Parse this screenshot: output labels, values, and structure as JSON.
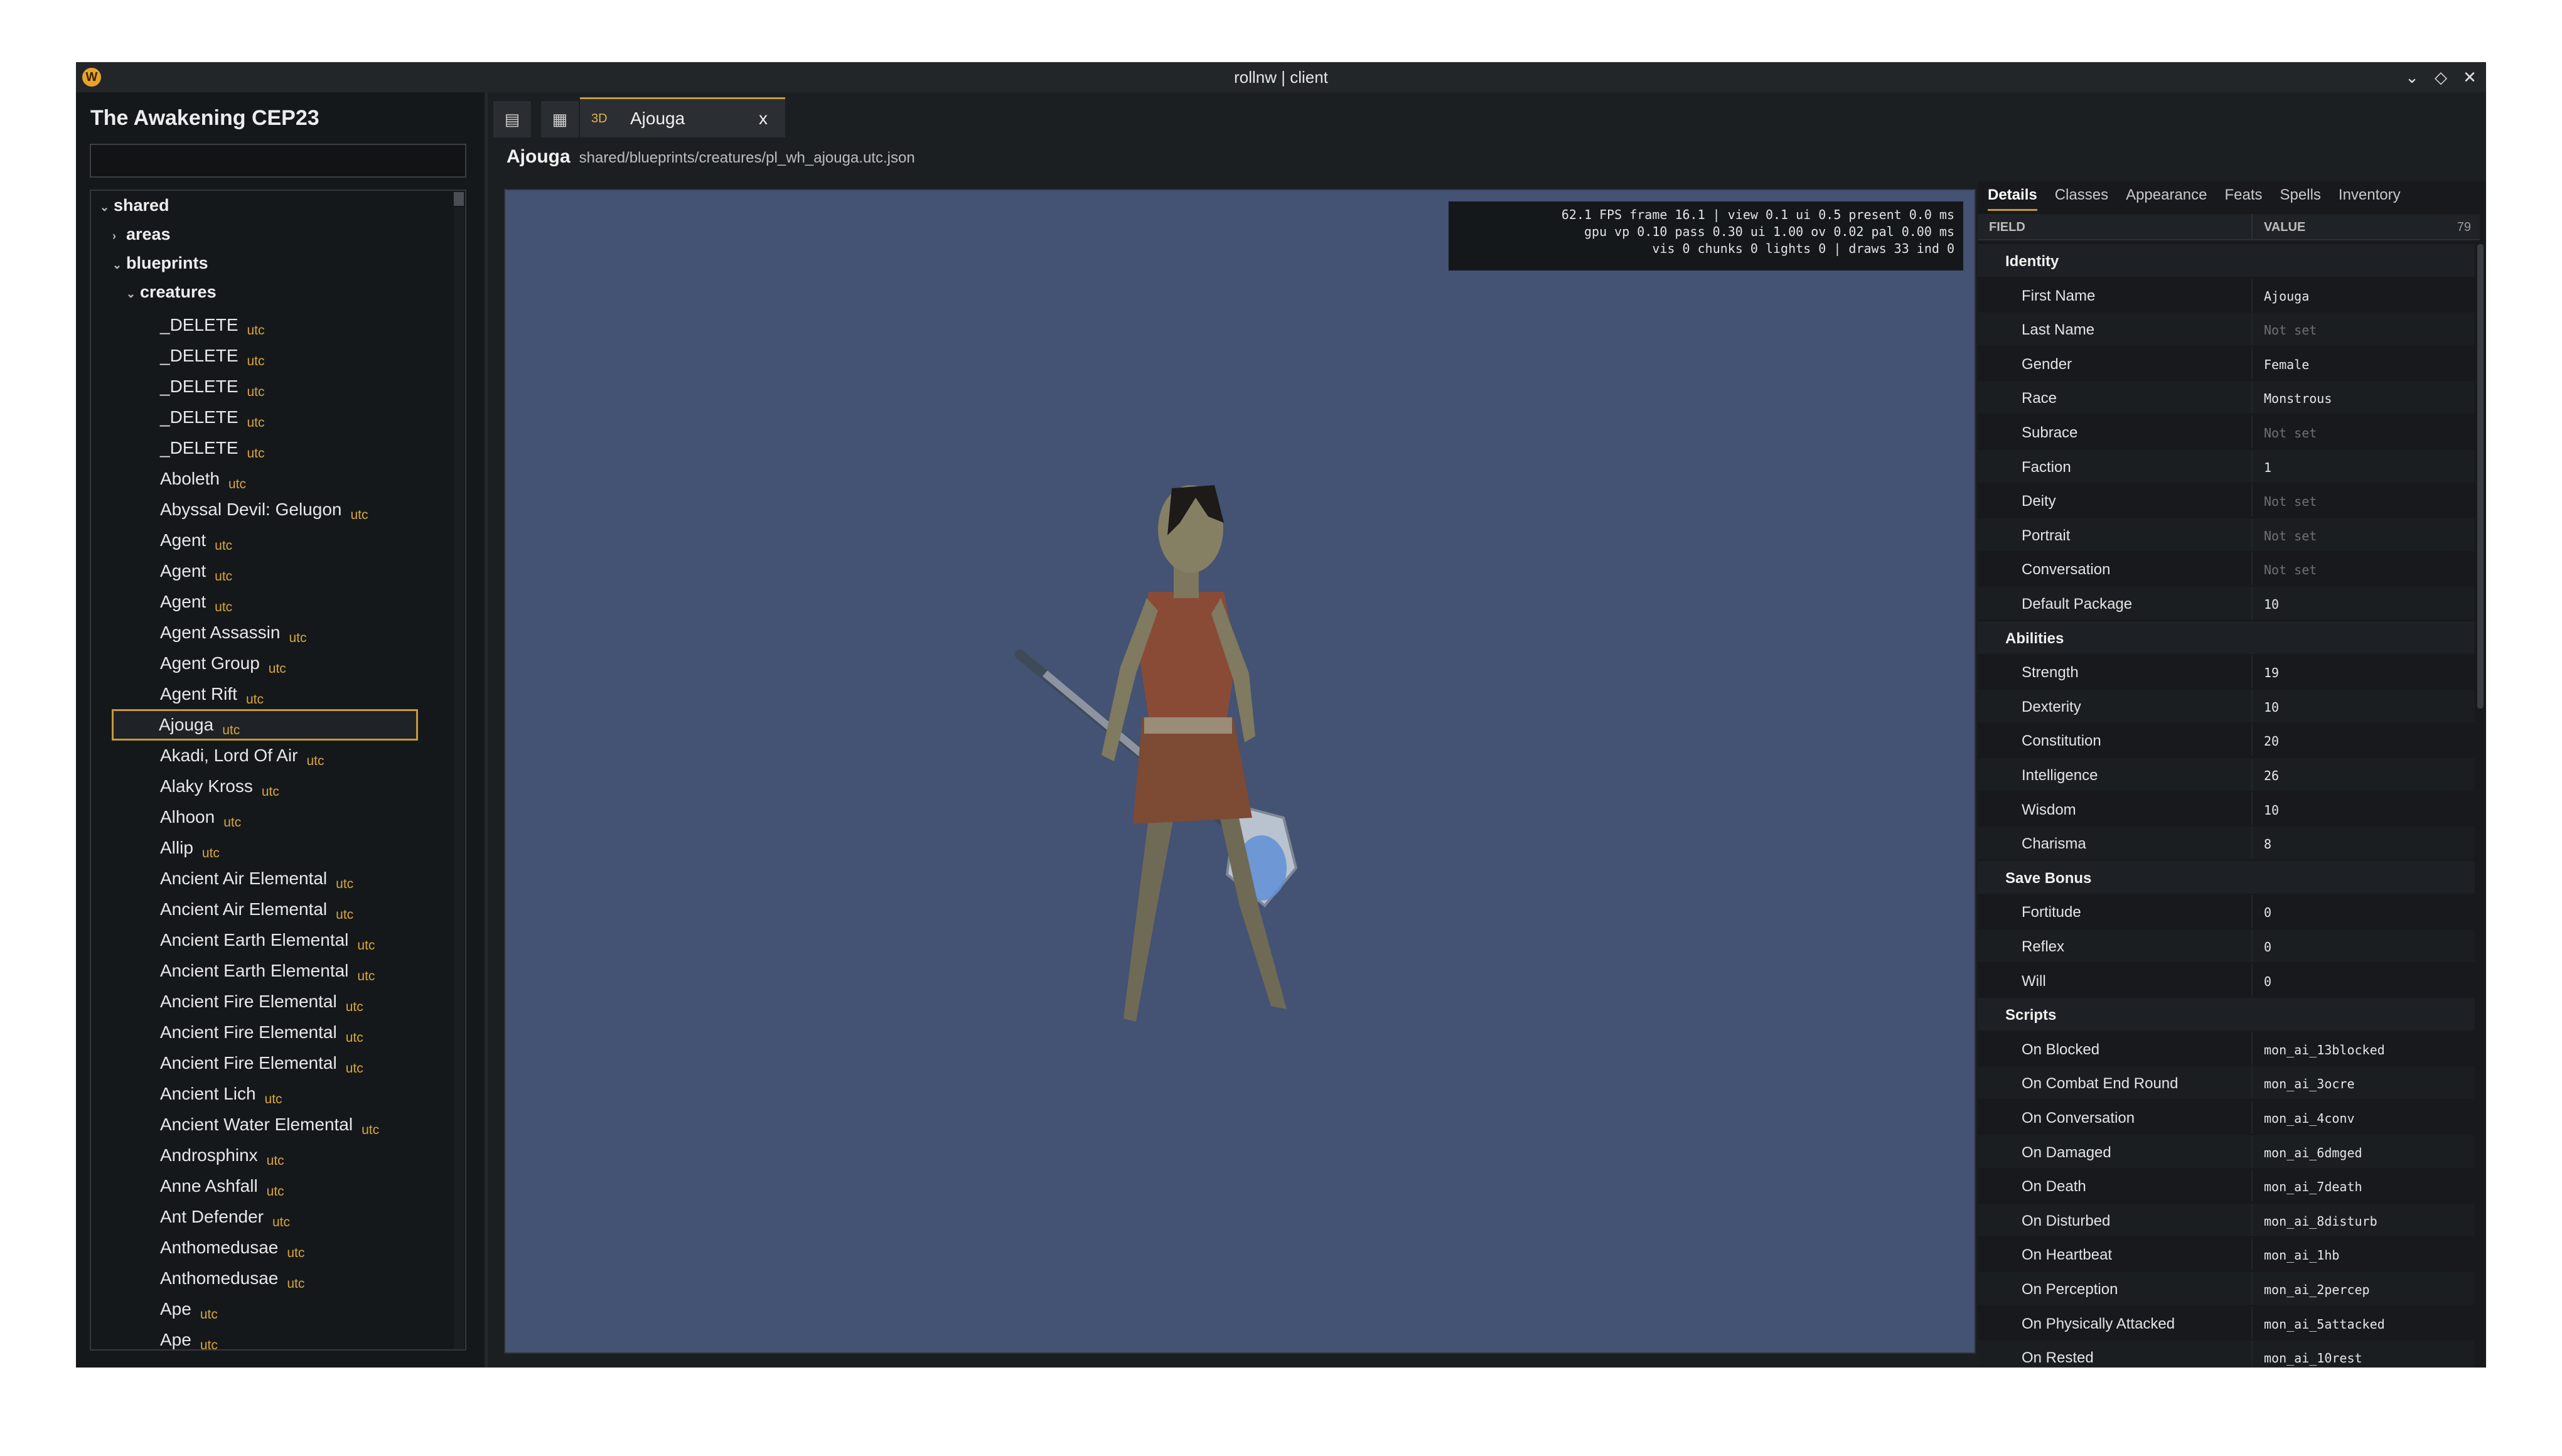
{
  "window": {
    "title": "rollnw | client",
    "logo_glyph": "W",
    "controls": [
      "⌄",
      "◇",
      "✕"
    ]
  },
  "sidebar": {
    "project_title": "The Awakening CEP23",
    "search_value": "",
    "folders": {
      "shared": "shared",
      "areas": "areas",
      "blueprints": "blueprints",
      "creatures": "creatures"
    },
    "items": [
      {
        "name": "_DELETE",
        "ext": "utc"
      },
      {
        "name": "_DELETE",
        "ext": "utc"
      },
      {
        "name": "_DELETE",
        "ext": "utc"
      },
      {
        "name": "_DELETE",
        "ext": "utc"
      },
      {
        "name": "_DELETE",
        "ext": "utc"
      },
      {
        "name": "Aboleth",
        "ext": "utc"
      },
      {
        "name": "Abyssal Devil: Gelugon",
        "ext": "utc"
      },
      {
        "name": "Agent",
        "ext": "utc"
      },
      {
        "name": "Agent",
        "ext": "utc"
      },
      {
        "name": "Agent",
        "ext": "utc"
      },
      {
        "name": "Agent Assassin",
        "ext": "utc"
      },
      {
        "name": "Agent Group",
        "ext": "utc"
      },
      {
        "name": "Agent Rift",
        "ext": "utc"
      },
      {
        "name": "Ajouga",
        "ext": "utc"
      },
      {
        "name": "Akadi, Lord Of Air",
        "ext": "utc"
      },
      {
        "name": "Alaky Kross",
        "ext": "utc"
      },
      {
        "name": "Alhoon",
        "ext": "utc"
      },
      {
        "name": "Allip",
        "ext": "utc"
      },
      {
        "name": "Ancient Air Elemental",
        "ext": "utc"
      },
      {
        "name": "Ancient Air Elemental",
        "ext": "utc"
      },
      {
        "name": "Ancient Earth Elemental",
        "ext": "utc"
      },
      {
        "name": "Ancient Earth Elemental",
        "ext": "utc"
      },
      {
        "name": "Ancient Fire Elemental",
        "ext": "utc"
      },
      {
        "name": "Ancient Fire Elemental",
        "ext": "utc"
      },
      {
        "name": "Ancient Fire Elemental",
        "ext": "utc"
      },
      {
        "name": "Ancient Lich",
        "ext": "utc"
      },
      {
        "name": "Ancient Water Elemental",
        "ext": "utc"
      },
      {
        "name": "Androsphinx",
        "ext": "utc"
      },
      {
        "name": "Anne Ashfall",
        "ext": "utc"
      },
      {
        "name": "Ant Defender",
        "ext": "utc"
      },
      {
        "name": "Anthomedusae",
        "ext": "utc"
      },
      {
        "name": "Anthomedusae",
        "ext": "utc"
      },
      {
        "name": "Ape",
        "ext": "utc"
      },
      {
        "name": "Ape",
        "ext": "utc"
      }
    ],
    "selected_index": 13
  },
  "editor": {
    "tab_badge": "3D",
    "tab_label": "Ajouga",
    "tab_close": "x",
    "breadcrumb_name": "Ajouga",
    "breadcrumb_path": "shared/blueprints/creatures/pl_wh_ajouga.utc.json",
    "stats": [
      "62.1 FPS frame 16.1 | view 0.1 ui 0.5 present 0.0 ms",
      "gpu vp 0.10 pass 0.30 ui 1.00 ov 0.02 pal 0.00 ms",
      "vis 0 chunks 0 lights 0 | draws 33 ind 0"
    ]
  },
  "properties": {
    "tabs": [
      "Details",
      "Classes",
      "Appearance",
      "Feats",
      "Spells",
      "Inventory"
    ],
    "active_tab": "Details",
    "header_field": "FIELD",
    "header_value": "VALUE",
    "row_count": "79",
    "rows": [
      {
        "group": "Identity"
      },
      {
        "field": "First Name",
        "value": "Ajouga"
      },
      {
        "field": "Last Name",
        "value": "Not set",
        "empty": true
      },
      {
        "field": "Gender",
        "value": "Female"
      },
      {
        "field": "Race",
        "value": "Monstrous"
      },
      {
        "field": "Subrace",
        "value": "Not set",
        "empty": true
      },
      {
        "field": "Faction",
        "value": "1"
      },
      {
        "field": "Deity",
        "value": "Not set",
        "empty": true
      },
      {
        "field": "Portrait",
        "value": "Not set",
        "empty": true
      },
      {
        "field": "Conversation",
        "value": "Not set",
        "empty": true
      },
      {
        "field": "Default Package",
        "value": "10"
      },
      {
        "group": "Abilities"
      },
      {
        "field": "Strength",
        "value": "19"
      },
      {
        "field": "Dexterity",
        "value": "10"
      },
      {
        "field": "Constitution",
        "value": "20"
      },
      {
        "field": "Intelligence",
        "value": "26"
      },
      {
        "field": "Wisdom",
        "value": "10"
      },
      {
        "field": "Charisma",
        "value": "8"
      },
      {
        "group": "Save Bonus"
      },
      {
        "field": "Fortitude",
        "value": "0"
      },
      {
        "field": "Reflex",
        "value": "0"
      },
      {
        "field": "Will",
        "value": "0"
      },
      {
        "group": "Scripts"
      },
      {
        "field": "On Blocked",
        "value": "mon_ai_13blocked"
      },
      {
        "field": "On Combat End Round",
        "value": "mon_ai_3ocre"
      },
      {
        "field": "On Conversation",
        "value": "mon_ai_4conv"
      },
      {
        "field": "On Damaged",
        "value": "mon_ai_6dmged"
      },
      {
        "field": "On Death",
        "value": "mon_ai_7death"
      },
      {
        "field": "On Disturbed",
        "value": "mon_ai_8disturb"
      },
      {
        "field": "On Heartbeat",
        "value": "mon_ai_1hb"
      },
      {
        "field": "On Perception",
        "value": "mon_ai_2percep"
      },
      {
        "field": "On Physically Attacked",
        "value": "mon_ai_5attacked"
      },
      {
        "field": "On Rested",
        "value": "mon_ai_10rest"
      }
    ]
  },
  "colors": {
    "accent": "#c69a39",
    "viewport_bg": "#445273",
    "ext_label": "#d9a53b"
  }
}
